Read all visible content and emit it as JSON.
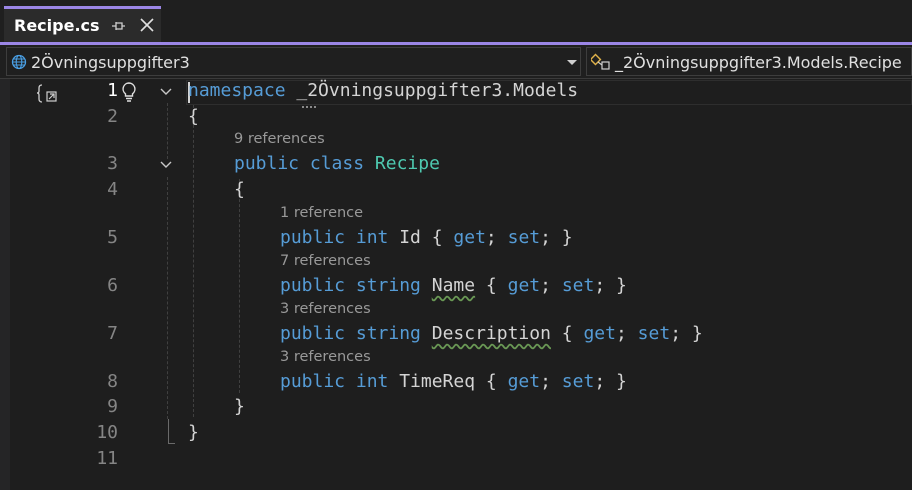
{
  "tab": {
    "title": "Recipe.cs"
  },
  "navbar": {
    "project": "2Övningsuppgifter3",
    "class_path": "_2Övningsuppgifter3.Models.Recipe"
  },
  "editor": {
    "line_numbers": [
      "1",
      "2",
      "3",
      "4",
      "5",
      "6",
      "7",
      "8",
      "9",
      "10",
      "11"
    ],
    "lines": {
      "l1_kw": "namespace",
      "l1_rest": " _2Övningsuppgifter3.Models",
      "l2": "{",
      "l3_kw": "public class",
      "l3_cls": "Recipe",
      "l4": "{",
      "l5_kw1": "public int",
      "l5_name": " Id { ",
      "l5_get": "get",
      "l5_mid": "; ",
      "l5_set": "set",
      "l5_end": "; }",
      "l6_kw1": "public string",
      "l6_name": "Name",
      "l6_open": " { ",
      "l6_get": "get",
      "l6_mid": "; ",
      "l6_set": "set",
      "l6_end": "; }",
      "l7_kw1": "public string",
      "l7_name": "Description",
      "l7_open": " { ",
      "l7_get": "get",
      "l7_mid": "; ",
      "l7_set": "set",
      "l7_end": "; }",
      "l8_kw1": "public int",
      "l8_name": " TimeReq { ",
      "l8_get": "get",
      "l8_mid": "; ",
      "l8_set": "set",
      "l8_end": "; }",
      "l9": "}",
      "l10": "}"
    },
    "codelens": {
      "class_refs": "9 references",
      "id_refs": "1 reference",
      "name_refs": "7 references",
      "desc_refs": "3 references",
      "time_refs": "3 references"
    }
  },
  "colors": {
    "accent": "#9b86e6",
    "keyword": "#569cd6",
    "type": "#4ec9b0",
    "codelens": "#999999"
  }
}
